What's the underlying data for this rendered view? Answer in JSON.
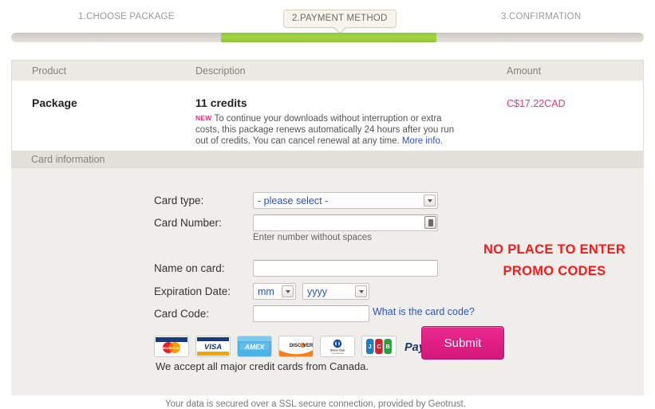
{
  "steps": {
    "step1": "1.CHOOSE PACKAGE",
    "step2": "2.PAYMENT METHOD",
    "step3": "3.CONFIRMATION",
    "progress_percent": 50,
    "active_color": "#8cc63f"
  },
  "product_table": {
    "headers": {
      "product": "Product",
      "description": "Description",
      "amount": "Amount"
    },
    "row": {
      "product": "Package",
      "description_title": "11 credits",
      "badge": "NEW",
      "description_body": "To continue your downloads without interruption or extra costs, this package renews automatically 24 hours after you run out of credits. You can cancel renewal at any time.",
      "more_info_link": "More info.",
      "amount": "C$17.22CAD",
      "amount_color": "#e8357f"
    }
  },
  "card_information": {
    "section_title": "Card information",
    "labels": {
      "card_type": "Card type:",
      "card_number": "Card Number:",
      "name_on_card": "Name on card:",
      "expiration_date": "Expiration Date:",
      "card_code": "Card Code:"
    },
    "card_type_value": "- please select -",
    "card_number_value": "",
    "card_number_hint": "Enter number without spaces",
    "name_on_card_value": "",
    "expiry_month_value": "mm",
    "expiry_year_value": "yyyy",
    "card_code_value": "",
    "card_code_link": "What is the card code?",
    "submit_label": "Submit"
  },
  "annotation": {
    "line1": "NO PLACE TO ENTER",
    "line2": "PROMO CODES",
    "color": "#fb1a1a"
  },
  "payment_logos": [
    {
      "name": "mastercard",
      "label": "MasterCard"
    },
    {
      "name": "visa",
      "label": "VISA"
    },
    {
      "name": "amex",
      "label": "AMEX"
    },
    {
      "name": "discover",
      "label": "DISCOVER"
    },
    {
      "name": "diners-club",
      "label": "Diners Club International"
    },
    {
      "name": "jcb",
      "label": "JCB"
    },
    {
      "name": "paypal",
      "label": "PayPal"
    }
  ],
  "footer": {
    "accept_text": "We accept all major credit cards from Canada.",
    "ssl_text": "Your data is secured over a SSL secure connection, provided by Geotrust."
  }
}
